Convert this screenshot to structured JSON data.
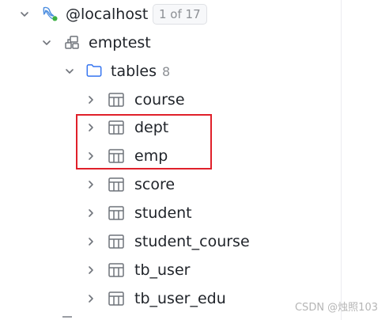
{
  "tree": {
    "host": {
      "label": "@localhost",
      "badge": "1 of 17",
      "icon": "mysql-dolphin-icon"
    },
    "schema": {
      "label": "emptest",
      "icon": "schema-icon"
    },
    "tables_folder": {
      "label": "tables",
      "count": "8",
      "icon": "folder-icon"
    },
    "tables": [
      {
        "label": "course"
      },
      {
        "label": "dept"
      },
      {
        "label": "emp"
      },
      {
        "label": "score"
      },
      {
        "label": "student"
      },
      {
        "label": "student_course"
      },
      {
        "label": "tb_user"
      },
      {
        "label": "tb_user_edu"
      }
    ]
  },
  "watermark": "CSDN @烛照103",
  "colors": {
    "highlight_border": "#e0202a",
    "folder_icon": "#3574f0",
    "dolphin_icon": "#4f8fe0",
    "status_dot": "#3cb043"
  }
}
